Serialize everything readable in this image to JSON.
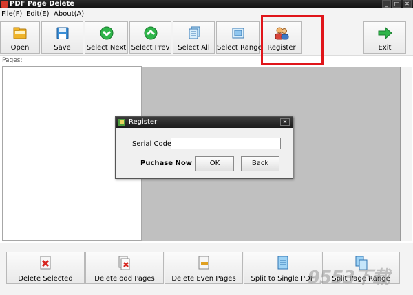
{
  "window": {
    "title": "PDF Page Delete",
    "min": "_",
    "max": "□",
    "close": "✕"
  },
  "menu": [
    "File(F)",
    "Edit(E)",
    "About(A)"
  ],
  "toolbar": {
    "open": "Open",
    "save": "Save",
    "select_next": "Select Next",
    "select_prev": "Select Prev",
    "select_all": "Select All",
    "select_range": "Select Range",
    "register": "Register",
    "exit": "Exit"
  },
  "pages_label": "Pages:",
  "bottom": {
    "delete_selected": "Delete Selected",
    "delete_odd": "Delete odd Pages",
    "delete_even": "Delete Even Pages",
    "split_single": "Split to Single PDF",
    "split_range": "Split Page Range"
  },
  "dialog": {
    "title": "Register",
    "close": "✕",
    "serial_label": "Serial Code:",
    "serial_value": "",
    "purchase_link": "Puchase Now",
    "ok": "OK",
    "back": "Back"
  },
  "watermark": "9553下载"
}
